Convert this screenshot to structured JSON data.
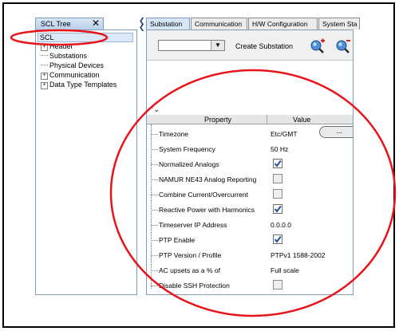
{
  "tree": {
    "tab_label": "SCL Tree",
    "close_glyph": "✕",
    "root": "SCL",
    "items": [
      {
        "label": "Header",
        "expandable": true
      },
      {
        "label": "Substations",
        "expandable": false
      },
      {
        "label": "Physical Devices",
        "expandable": false
      },
      {
        "label": "Communication",
        "expandable": true
      },
      {
        "label": "Data Type Templates",
        "expandable": true
      }
    ]
  },
  "tabs": [
    "Substation",
    "Communication",
    "H/W Configuration",
    "System Sta"
  ],
  "toolbar": {
    "combo_value": "",
    "create_label": "Create Substation",
    "zoom_in_icon": "zoom-in-icon",
    "zoom_out_icon": "zoom-out-icon"
  },
  "property_grid": {
    "header_property": "Property",
    "header_value": "Value",
    "ellipsis_label": "...",
    "rows": [
      {
        "name": "Timezone",
        "value": "Etc/GMT",
        "type": "text"
      },
      {
        "name": "System Frequency",
        "value": "50 Hz",
        "type": "text"
      },
      {
        "name": "Normalized Analogs",
        "checked": true,
        "type": "checkbox"
      },
      {
        "name": "NAMUR NE43 Analog Reporting",
        "checked": false,
        "type": "checkbox"
      },
      {
        "name": "Combine Current/Overcurrent",
        "checked": false,
        "type": "checkbox"
      },
      {
        "name": "Reactive Power with Harmonics",
        "checked": true,
        "type": "checkbox"
      },
      {
        "name": "Timeserver IP Address",
        "value": "0.0.0.0",
        "type": "text"
      },
      {
        "name": "PTP Enable",
        "checked": true,
        "type": "checkbox"
      },
      {
        "name": "PTP Version / Profile",
        "value": "PTPv1 1588-2002",
        "type": "text"
      },
      {
        "name": "AC upsets as a % of",
        "value": "Full scale",
        "type": "text"
      },
      {
        "name": "Disable SSH Protection",
        "checked": false,
        "type": "checkbox"
      }
    ]
  },
  "colors": {
    "annotation_red": "#e8141c",
    "check_blue": "#1f4f9a",
    "tab_active": "#d7e6f6"
  }
}
